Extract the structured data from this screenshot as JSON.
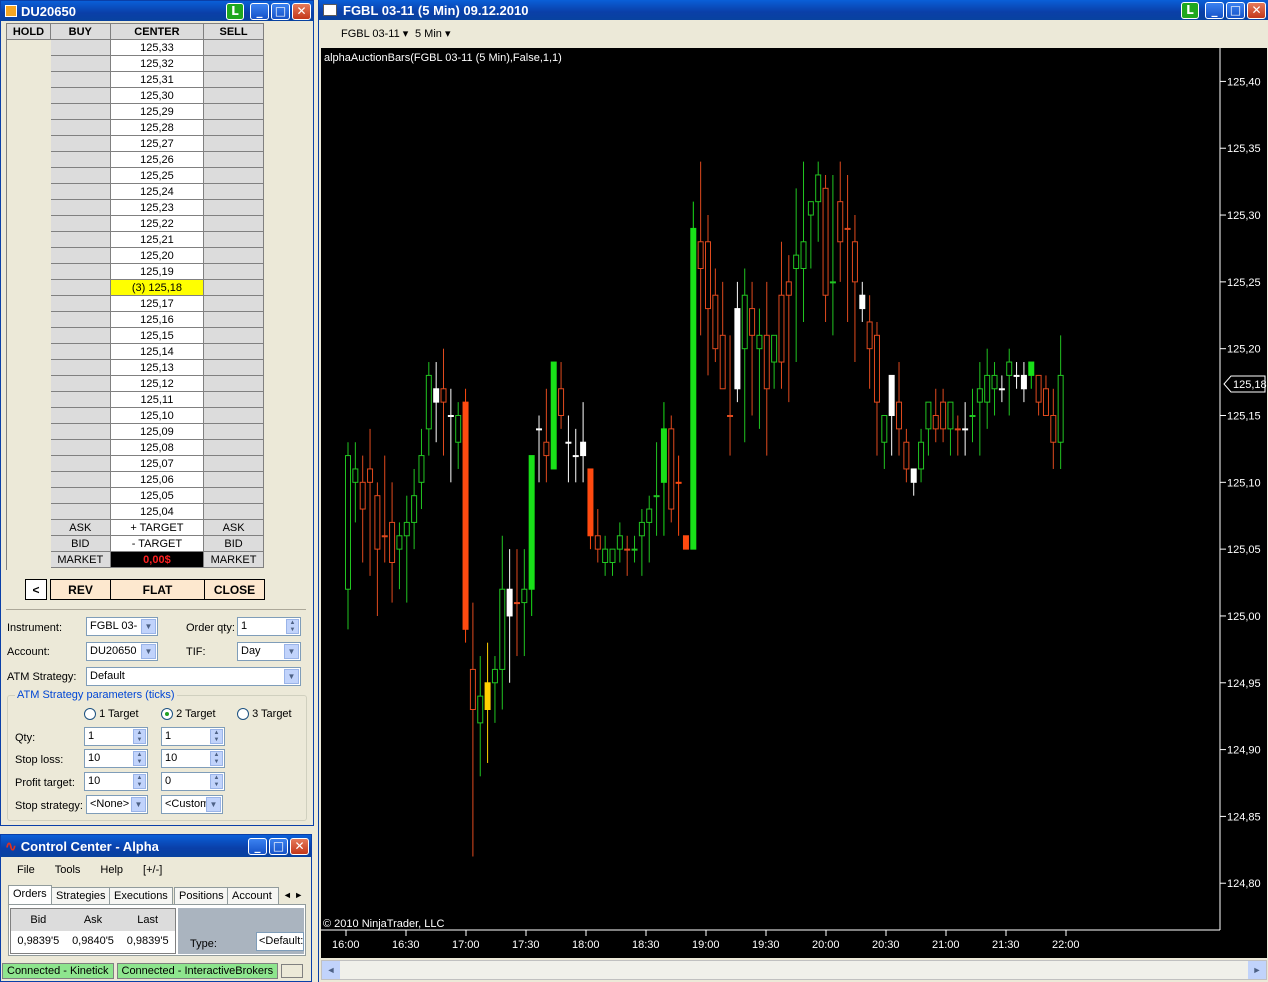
{
  "dom_window": {
    "title": "DU20650",
    "hold": "HOLD",
    "buy": "BUY",
    "center": "CENTER",
    "sell": "SELL",
    "prices": [
      "125,33",
      "125,32",
      "125,31",
      "125,30",
      "125,29",
      "125,28",
      "125,27",
      "125,26",
      "125,25",
      "125,24",
      "125,23",
      "125,22",
      "125,21",
      "125,20",
      "125,19",
      "(3) 125,18",
      "125,17",
      "125,16",
      "125,15",
      "125,14",
      "125,13",
      "125,12",
      "125,11",
      "125,10",
      "125,09",
      "125,08",
      "125,07",
      "125,06",
      "125,05",
      "125,04"
    ],
    "highlight_index": 15,
    "highlight_color": "#ffff00",
    "row_ask": [
      "ASK",
      "+ TARGET",
      "ASK"
    ],
    "row_bid": [
      "BID",
      "- TARGET",
      "BID"
    ],
    "row_market": [
      "MARKET",
      "0,00$",
      "MARKET"
    ],
    "pnl_color": "#ff2020",
    "arrow": "<",
    "rev": "REV",
    "flat": "FLAT",
    "close": "CLOSE",
    "instrument_label": "Instrument:",
    "instrument": "FGBL 03-",
    "order_qty_label": "Order qty:",
    "order_qty": "1",
    "account_label": "Account:",
    "account": "DU20650",
    "tif_label": "TIF:",
    "tif": "Day",
    "atm_label": "ATM Strategy:",
    "atm": "Default",
    "atm_params": "ATM Strategy parameters (ticks)",
    "target1": "1 Target",
    "target2": "2 Target",
    "target3": "3 Target",
    "qty_label": "Qty:",
    "qty1": "1",
    "qty2": "1",
    "stop_label": "Stop loss:",
    "stop1": "10",
    "stop2": "10",
    "profit_label": "Profit target:",
    "profit1": "10",
    "profit2": "0",
    "stopstrat_label": "Stop strategy:",
    "stopstrat1": "<None>",
    "stopstrat2": "<Custom"
  },
  "control_center": {
    "title": "Control Center - Alpha",
    "menu": [
      "File",
      "Tools",
      "Help",
      "[+/-]"
    ],
    "tabs": [
      "Orders",
      "Strategies",
      "Executions",
      "Positions",
      "Account"
    ],
    "quote_headers": [
      "Bid",
      "Ask",
      "Last"
    ],
    "quote_values": [
      "0,9839'5",
      "0,9840'5",
      "0,9839'5"
    ],
    "type_label": "Type:",
    "type_value": "<Default:",
    "status": [
      "Connected - Kinetick",
      "Connected - InteractiveBrokers"
    ]
  },
  "chart_window": {
    "title": "FGBL 03-11 (5 Min)  09.12.2010",
    "instrument": "FGBL 03-11",
    "interval": "5 Min",
    "indicator": "alphaAuctionBars(FGBL 03-11 (5 Min),False,1,1)",
    "copyright": "© 2010 NinjaTrader, LLC",
    "last_price": "125,18"
  },
  "chart_data": {
    "type": "candlestick",
    "x_ticks": [
      "16:00",
      "16:30",
      "17:00",
      "17:30",
      "18:00",
      "18:30",
      "19:00",
      "19:30",
      "20:00",
      "20:30",
      "21:00",
      "21:30",
      "22:00"
    ],
    "y_ticks": [
      "125,40",
      "125,35",
      "125,30",
      "125,25",
      "125,20",
      "125,15",
      "125,10",
      "125,05",
      "125,00",
      "124,95",
      "124,90",
      "124,85",
      "124,80"
    ],
    "ylim": [
      124.765,
      125.425
    ],
    "x_start_time": "16:00",
    "x_step_minutes": 5,
    "bars": [
      [
        125.12,
        125.13,
        124.99,
        125.02,
        "g"
      ],
      [
        125.11,
        125.13,
        125.07,
        125.1,
        "g"
      ],
      [
        125.1,
        125.12,
        125.04,
        125.08,
        "r"
      ],
      [
        125.11,
        125.14,
        125.03,
        125.1,
        "r"
      ],
      [
        125.09,
        125.1,
        125.0,
        125.05,
        "r"
      ],
      [
        125.06,
        125.12,
        125.04,
        125.06,
        "r"
      ],
      [
        125.04,
        125.1,
        125.01,
        125.07,
        "r"
      ],
      [
        125.05,
        125.07,
        125.02,
        125.06,
        "g"
      ],
      [
        125.07,
        125.09,
        125.01,
        125.06,
        "g"
      ],
      [
        125.09,
        125.11,
        125.05,
        125.07,
        "g"
      ],
      [
        125.1,
        125.14,
        125.08,
        125.12,
        "g"
      ],
      [
        125.14,
        125.19,
        125.12,
        125.18,
        "g"
      ],
      [
        125.16,
        125.19,
        125.13,
        125.17,
        "w"
      ],
      [
        125.17,
        125.2,
        125.12,
        125.16,
        "r"
      ],
      [
        125.15,
        125.17,
        125.1,
        125.15,
        "w"
      ],
      [
        125.15,
        125.16,
        125.11,
        125.13,
        "g"
      ],
      [
        125.16,
        125.17,
        124.98,
        124.99,
        "R"
      ],
      [
        124.96,
        125.01,
        124.82,
        124.93,
        "r"
      ],
      [
        124.92,
        124.97,
        124.88,
        124.94,
        "g"
      ],
      [
        124.93,
        124.98,
        124.89,
        124.95,
        "Y"
      ],
      [
        124.95,
        124.97,
        124.92,
        124.96,
        "g"
      ],
      [
        124.96,
        125.06,
        124.93,
        125.02,
        "g"
      ],
      [
        125.0,
        125.05,
        124.95,
        125.02,
        "w"
      ],
      [
        125.01,
        125.05,
        124.97,
        125.01,
        "r"
      ],
      [
        125.01,
        125.05,
        124.97,
        125.02,
        "g"
      ],
      [
        125.02,
        125.08,
        125.0,
        125.12,
        "G"
      ],
      [
        125.14,
        125.15,
        125.1,
        125.14,
        "w"
      ],
      [
        125.13,
        125.17,
        125.1,
        125.12,
        "r"
      ],
      [
        125.11,
        125.19,
        125.11,
        125.19,
        "G"
      ],
      [
        125.17,
        125.19,
        125.14,
        125.15,
        "r"
      ],
      [
        125.13,
        125.15,
        125.1,
        125.13,
        "w"
      ],
      [
        125.12,
        125.14,
        125.1,
        125.12,
        "w"
      ],
      [
        125.13,
        125.16,
        125.1,
        125.12,
        "w"
      ],
      [
        125.11,
        125.11,
        125.05,
        125.06,
        "R"
      ],
      [
        125.06,
        125.08,
        125.04,
        125.05,
        "r"
      ],
      [
        125.05,
        125.06,
        125.03,
        125.04,
        "g"
      ],
      [
        125.04,
        125.05,
        125.03,
        125.05,
        "g"
      ],
      [
        125.05,
        125.07,
        125.04,
        125.06,
        "g"
      ],
      [
        125.05,
        125.06,
        125.03,
        125.05,
        "r"
      ],
      [
        125.05,
        125.06,
        125.04,
        125.05,
        "g"
      ],
      [
        125.06,
        125.08,
        125.03,
        125.07,
        "g"
      ],
      [
        125.08,
        125.09,
        125.04,
        125.07,
        "g"
      ],
      [
        125.09,
        125.13,
        125.06,
        125.09,
        "g"
      ],
      [
        125.1,
        125.16,
        125.06,
        125.14,
        "G"
      ],
      [
        125.14,
        125.15,
        125.07,
        125.08,
        "r"
      ],
      [
        125.1,
        125.12,
        125.06,
        125.1,
        "R"
      ],
      [
        125.06,
        125.06,
        125.05,
        125.05,
        "R"
      ],
      [
        125.05,
        125.31,
        125.05,
        125.29,
        "G"
      ],
      [
        125.28,
        125.34,
        125.21,
        125.26,
        "r"
      ],
      [
        125.28,
        125.3,
        125.18,
        125.23,
        "r"
      ],
      [
        125.24,
        125.26,
        125.19,
        125.2,
        "r"
      ],
      [
        125.21,
        125.25,
        125.18,
        125.17,
        "r"
      ],
      [
        125.15,
        125.21,
        125.12,
        125.15,
        "r"
      ],
      [
        125.17,
        125.25,
        125.16,
        125.23,
        "w"
      ],
      [
        125.2,
        125.26,
        125.13,
        125.24,
        "g"
      ],
      [
        125.23,
        125.25,
        125.15,
        125.21,
        "r"
      ],
      [
        125.2,
        125.23,
        125.14,
        125.21,
        "g"
      ],
      [
        125.21,
        125.25,
        125.12,
        125.17,
        "r"
      ],
      [
        125.19,
        125.21,
        125.17,
        125.21,
        "g"
      ],
      [
        125.19,
        125.28,
        125.17,
        125.24,
        "r"
      ],
      [
        125.25,
        125.27,
        125.16,
        125.24,
        "r"
      ],
      [
        125.27,
        125.32,
        125.19,
        125.26,
        "g"
      ],
      [
        125.26,
        125.34,
        125.22,
        125.28,
        "g"
      ],
      [
        125.31,
        125.29,
        125.26,
        125.3,
        "g"
      ],
      [
        125.33,
        125.34,
        125.28,
        125.31,
        "g"
      ],
      [
        125.32,
        125.33,
        125.22,
        125.24,
        "r"
      ],
      [
        125.25,
        125.33,
        125.21,
        125.25,
        "g"
      ],
      [
        125.31,
        125.34,
        125.25,
        125.28,
        "r"
      ],
      [
        125.29,
        125.33,
        125.22,
        125.29,
        "r"
      ],
      [
        125.28,
        125.3,
        125.19,
        125.25,
        "r"
      ],
      [
        125.24,
        125.25,
        125.22,
        125.23,
        "w"
      ],
      [
        125.22,
        125.24,
        125.17,
        125.2,
        "r"
      ],
      [
        125.21,
        125.22,
        125.12,
        125.16,
        "r"
      ],
      [
        125.15,
        125.15,
        125.11,
        125.13,
        "g"
      ],
      [
        125.18,
        125.17,
        125.12,
        125.15,
        "w"
      ],
      [
        125.16,
        125.19,
        125.12,
        125.14,
        "r"
      ],
      [
        125.13,
        125.14,
        125.1,
        125.11,
        "r"
      ],
      [
        125.1,
        125.11,
        125.09,
        125.11,
        "w"
      ],
      [
        125.11,
        125.14,
        125.1,
        125.13,
        "g"
      ],
      [
        125.14,
        125.16,
        125.12,
        125.16,
        "g"
      ],
      [
        125.15,
        125.17,
        125.13,
        125.14,
        "r"
      ],
      [
        125.16,
        125.17,
        125.13,
        125.14,
        "r"
      ],
      [
        125.16,
        125.16,
        125.12,
        125.14,
        "g"
      ],
      [
        125.14,
        125.15,
        125.12,
        125.14,
        "r"
      ],
      [
        125.14,
        125.16,
        125.12,
        125.14,
        "w"
      ],
      [
        125.15,
        125.17,
        125.13,
        125.15,
        "g"
      ],
      [
        125.16,
        125.19,
        125.12,
        125.17,
        "g"
      ],
      [
        125.18,
        125.2,
        125.14,
        125.16,
        "g"
      ],
      [
        125.17,
        125.19,
        125.15,
        125.18,
        "g"
      ],
      [
        125.17,
        125.18,
        125.16,
        125.17,
        "w"
      ],
      [
        125.18,
        125.2,
        125.15,
        125.19,
        "g"
      ],
      [
        125.18,
        125.19,
        125.17,
        125.18,
        "w"
      ],
      [
        125.17,
        125.19,
        125.16,
        125.18,
        "w"
      ],
      [
        125.19,
        125.19,
        125.17,
        125.18,
        "G"
      ],
      [
        125.18,
        125.18,
        125.15,
        125.16,
        "r"
      ],
      [
        125.17,
        125.18,
        125.15,
        125.15,
        "r"
      ],
      [
        125.15,
        125.17,
        125.11,
        125.13,
        "r"
      ],
      [
        125.13,
        125.21,
        125.11,
        125.18,
        "g"
      ]
    ]
  }
}
